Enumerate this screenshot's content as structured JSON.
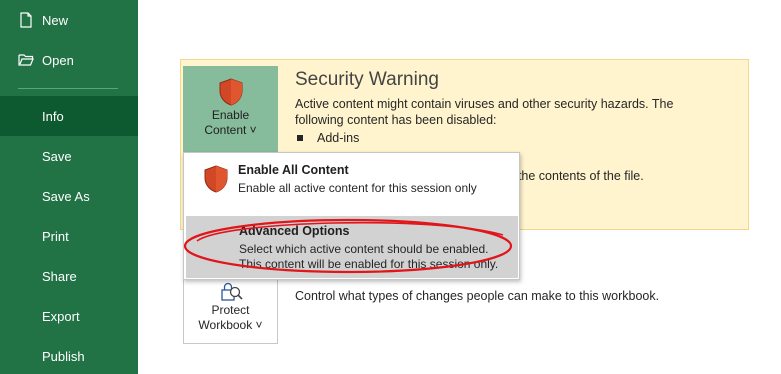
{
  "sidebar": {
    "items": [
      {
        "label": "New",
        "icon": "new-document-icon"
      },
      {
        "label": "Open",
        "icon": "open-folder-icon"
      },
      {
        "label": "Info",
        "active": true
      },
      {
        "label": "Save"
      },
      {
        "label": "Save As"
      },
      {
        "label": "Print"
      },
      {
        "label": "Share"
      },
      {
        "label": "Export"
      },
      {
        "label": "Publish"
      }
    ],
    "background": "#217346",
    "active_background": "#0e5a30"
  },
  "security_warning": {
    "enable_button": {
      "line1": "Enable",
      "line2": "Content ˅",
      "icon": "shield-icon"
    },
    "title": "Security Warning",
    "description": "Active content might contain viruses and other security hazards. The following content has been disabled:",
    "bullets": [
      "Add-ins"
    ],
    "partial_text": "t the contents of the file.",
    "background": "#fff4ce"
  },
  "dropdown": {
    "items": [
      {
        "title": "Enable All Content",
        "desc": "Enable all active content for this session only",
        "icon": "shield-icon"
      },
      {
        "title": "Advanced Options",
        "desc": "Select which active content should be enabled. This content will be enabled for this session only."
      }
    ],
    "highlight": "#d2d2d2"
  },
  "protect": {
    "line1": "Protect",
    "line2": "Workbook ˅",
    "icon": "lock-magnifier-icon",
    "description": "Control what types of changes people can make to this workbook."
  },
  "annotation_color": "#e0161b"
}
